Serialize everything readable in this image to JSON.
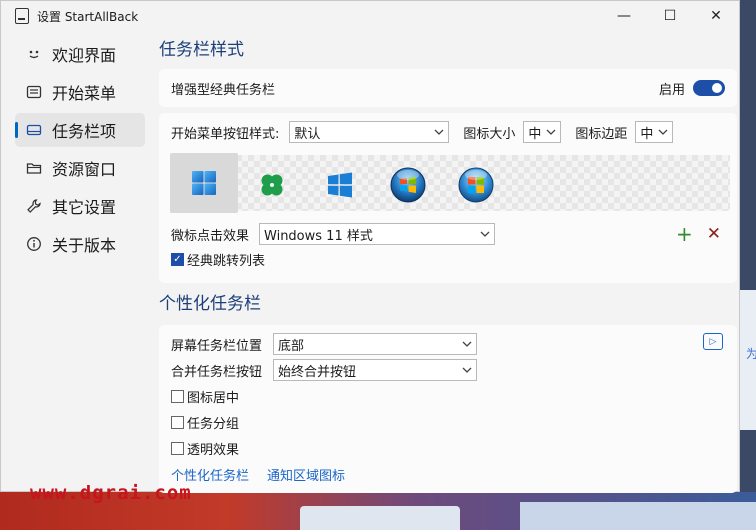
{
  "window": {
    "title": "设置 StartAllBack"
  },
  "window_buttons": {
    "minimize": "—",
    "maximize": "☐",
    "close": "✕"
  },
  "sidebar": {
    "items": [
      {
        "label": "欢迎界面",
        "icon": "smile-icon",
        "glyph": "ᵕ̈"
      },
      {
        "label": "开始菜单",
        "icon": "start-menu-icon",
        "glyph": "▤"
      },
      {
        "label": "任务栏项",
        "icon": "taskbar-icon",
        "glyph": "▭",
        "active": true
      },
      {
        "label": "资源窗口",
        "icon": "folder-icon",
        "glyph": "🗀"
      },
      {
        "label": "其它设置",
        "icon": "wrench-icon",
        "glyph": "🔧"
      },
      {
        "label": "关于版本",
        "icon": "info-icon",
        "glyph": "ⓘ"
      }
    ]
  },
  "taskbar_style": {
    "section_title": "任务栏样式",
    "enhanced_label": "增强型经典任务栏",
    "enable_label": "启用",
    "enabled": true,
    "start_button_label": "开始菜单按钮样式:",
    "start_button_value": "默认",
    "icon_size_label": "图标大小",
    "icon_size_value": "中",
    "icon_margin_label": "图标边距",
    "icon_margin_value": "中",
    "start_icons": [
      "windows-11-logo-icon",
      "clover-icon",
      "windows-10-logo-icon",
      "windows-7-orb-icon",
      "windows-vista-orb-icon"
    ],
    "selected_icon_index": 0,
    "click_effect_label": "微标点击效果",
    "click_effect_value": "Windows 11 样式",
    "add_glyph": "+",
    "remove_glyph": "✕",
    "jumplist_label": "经典跳转列表",
    "jumplist_checked": true,
    "check_glyph": "✓"
  },
  "personalize": {
    "section_title": "个性化任务栏",
    "position_label": "屏幕任务栏位置",
    "position_value": "底部",
    "combine_label": "合并任务栏按钮",
    "combine_value": "始终合并按钮",
    "center_icons_label": "图标居中",
    "group_label": "任务分组",
    "transparent_label": "透明效果",
    "link1": "个性化任务栏",
    "link2": "通知区域图标",
    "play_glyph": "▷"
  },
  "desktop": {
    "side_text": "为"
  },
  "watermark": "www.dgrai.com",
  "colors": {
    "accent": "#1e4fa8",
    "section_title": "#1c3f7a",
    "link": "#1a66c8",
    "add": "#2e8b2e",
    "remove": "#8b2020",
    "watermark": "#c4161c"
  }
}
